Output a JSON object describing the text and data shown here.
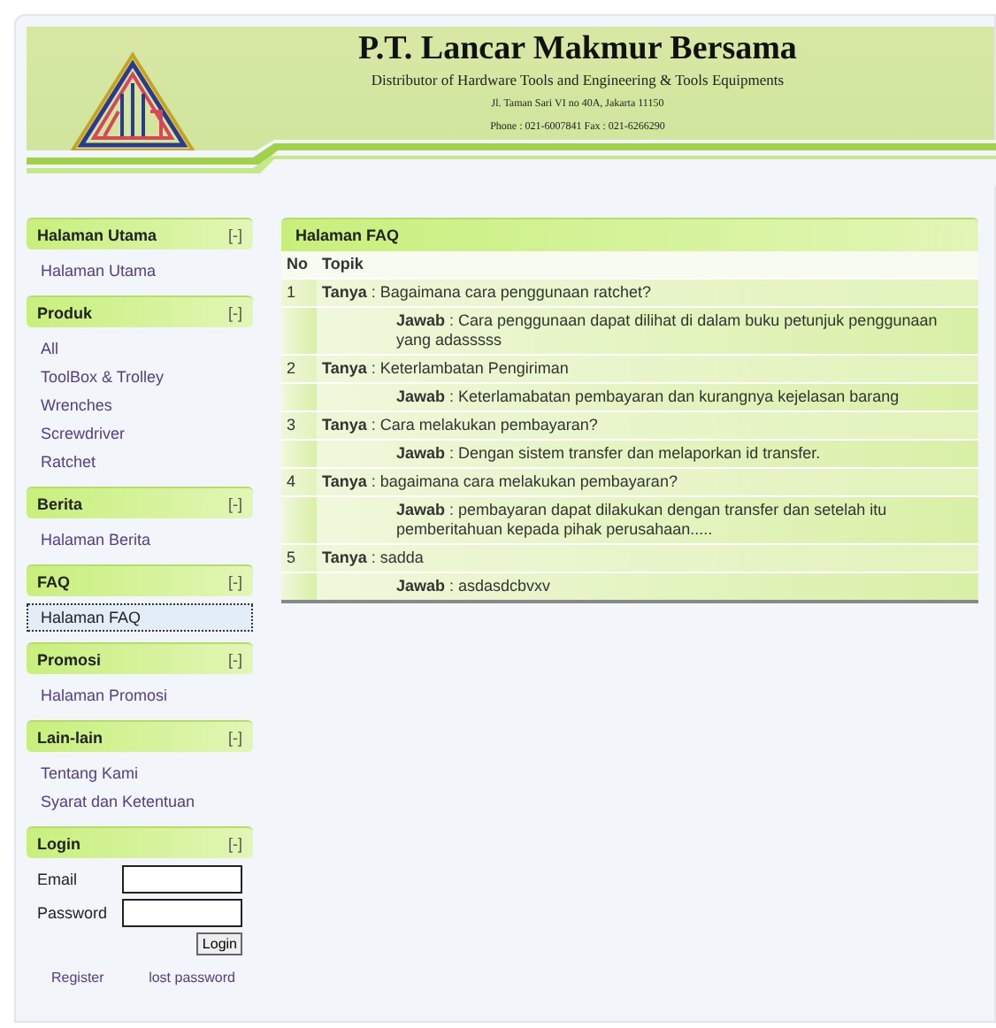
{
  "header": {
    "company": "P.T. Lancar Makmur Bersama",
    "tagline": "Distributor of Hardware Tools and Engineering & Tools Equipments",
    "address": "Jl. Taman Sari VI no 40A, Jakarta 11150",
    "phone": "Phone : 021-6007841 Fax : 021-6266290"
  },
  "sidebar": [
    {
      "kind": "menu",
      "title": "Halaman Utama",
      "toggle": "[-]",
      "items": [
        {
          "label": "Halaman Utama",
          "selected": false
        }
      ]
    },
    {
      "kind": "menu",
      "title": "Produk",
      "toggle": "[-]",
      "items": [
        {
          "label": "All",
          "selected": false
        },
        {
          "label": "ToolBox & Trolley",
          "selected": false
        },
        {
          "label": "Wrenches",
          "selected": false
        },
        {
          "label": "Screwdriver",
          "selected": false
        },
        {
          "label": "Ratchet",
          "selected": false
        }
      ]
    },
    {
      "kind": "menu",
      "title": "Berita",
      "toggle": "[-]",
      "items": [
        {
          "label": "Halaman Berita",
          "selected": false
        }
      ]
    },
    {
      "kind": "menu",
      "title": "FAQ",
      "toggle": "[-]",
      "items": [
        {
          "label": "Halaman FAQ",
          "selected": true
        }
      ]
    },
    {
      "kind": "menu",
      "title": "Promosi",
      "toggle": "[-]",
      "items": [
        {
          "label": "Halaman Promosi",
          "selected": false
        }
      ]
    },
    {
      "kind": "menu",
      "title": "Lain-lain",
      "toggle": "[-]",
      "items": [
        {
          "label": "Tentang Kami",
          "selected": false
        },
        {
          "label": "Syarat dan Ketentuan",
          "selected": false
        }
      ]
    },
    {
      "kind": "login",
      "title": "Login",
      "toggle": "[-]",
      "email_label": "Email",
      "password_label": "Password",
      "button": "Login",
      "links": [
        "Register",
        "lost password"
      ]
    }
  ],
  "faq": {
    "title": "Halaman FAQ",
    "columns": [
      "No",
      "Topik"
    ],
    "rows": [
      {
        "no": "1",
        "question": "**Tanya** : Bagaimana cara penggunaan ratchet?",
        "answer": "**Jawab** : Cara penggunaan dapat dilihat di dalam buku petunjuk penggunaan yang adasssss"
      },
      {
        "no": "2",
        "question": "**Tanya** : Keterlambatan Pengiriman",
        "answer": "**Jawab** : Keterlamabatan pembayaran dan kurangnya kejelasan barang"
      },
      {
        "no": "3",
        "question": "**Tanya** : Cara melakukan pembayaran?",
        "answer": "**Jawab** : Dengan sistem transfer dan melaporkan id transfer."
      },
      {
        "no": "4",
        "question": "**Tanya** : bagaimana cara melakukan pembayaran?",
        "answer": "**Jawab** : pembayaran dapat dilakukan dengan transfer dan setelah itu pemberitahuan kepada pihak perusahaan....."
      },
      {
        "no": "5",
        "question": "**Tanya** : sadda",
        "answer": "**Jawab** : asdasdcbvxv"
      }
    ]
  }
}
